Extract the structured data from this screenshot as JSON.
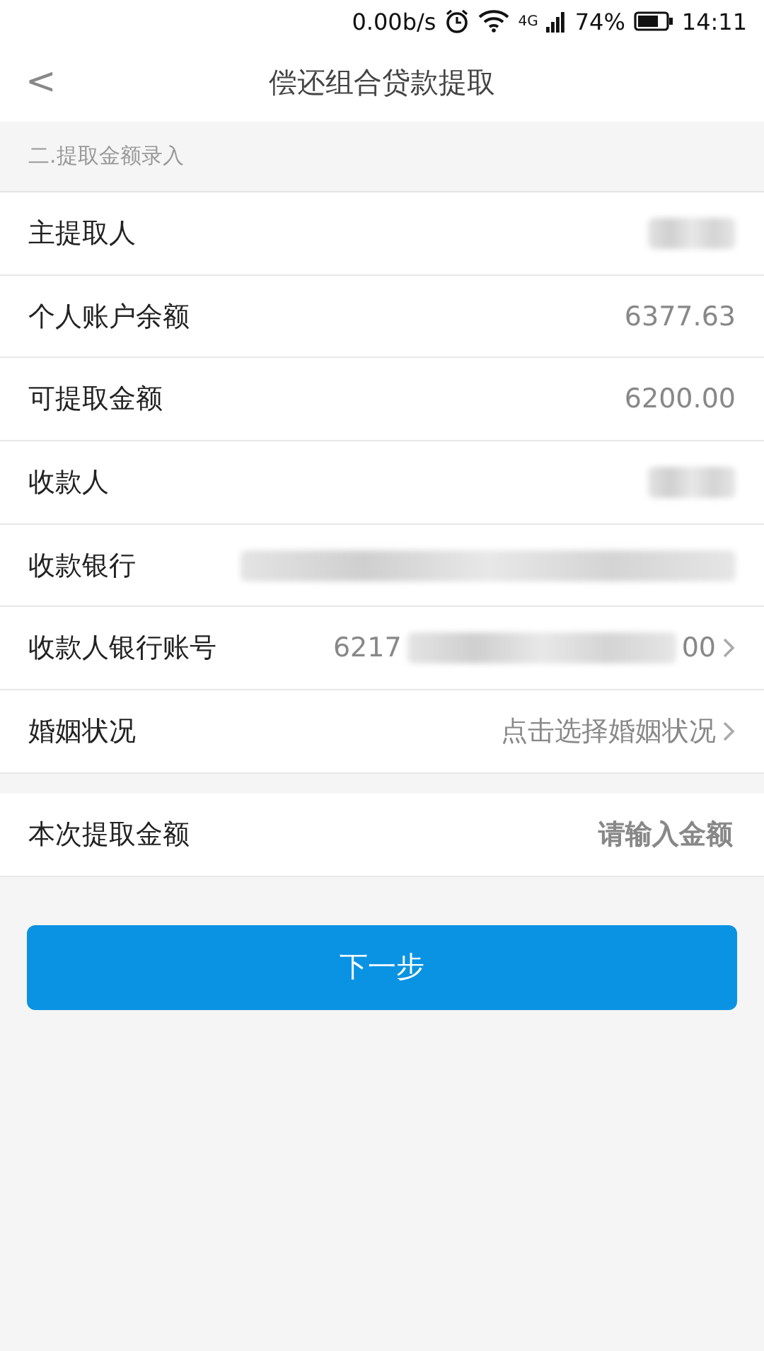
{
  "status_bar": {
    "speed": "0.00b/s",
    "network": "4G",
    "battery": "74%",
    "time": "14:11"
  },
  "nav": {
    "back": "<",
    "title": "偿还组合贷款提取"
  },
  "section": {
    "title": "二.提取金额录入"
  },
  "rows": [
    {
      "label": "主提取人",
      "parts": [
        {
          "kind": "mask"
        }
      ],
      "chevron": false
    },
    {
      "label": "个人账户余额",
      "parts": [
        {
          "kind": "text",
          "text": "6377.63"
        }
      ],
      "chevron": false
    },
    {
      "label": "可提取金额",
      "parts": [
        {
          "kind": "text",
          "text": "6200.00"
        }
      ],
      "chevron": false
    },
    {
      "label": "收款人",
      "parts": [
        {
          "kind": "mask"
        }
      ],
      "chevron": false
    },
    {
      "label": "收款银行",
      "parts": [
        {
          "kind": "maskwide"
        }
      ],
      "chevron": false
    },
    {
      "label": "收款人银行账号",
      "parts": [
        {
          "kind": "text",
          "text": "6217"
        },
        {
          "kind": "maskmid"
        },
        {
          "kind": "text",
          "text": "00"
        }
      ],
      "chevron": true
    },
    {
      "label": "婚姻状况",
      "parts": [
        {
          "kind": "text",
          "text": "点击选择婚姻状况"
        }
      ],
      "chevron": true
    }
  ],
  "amount": {
    "label": "本次提取金额",
    "placeholder": "请输入金额"
  },
  "next_button": "下一步"
}
